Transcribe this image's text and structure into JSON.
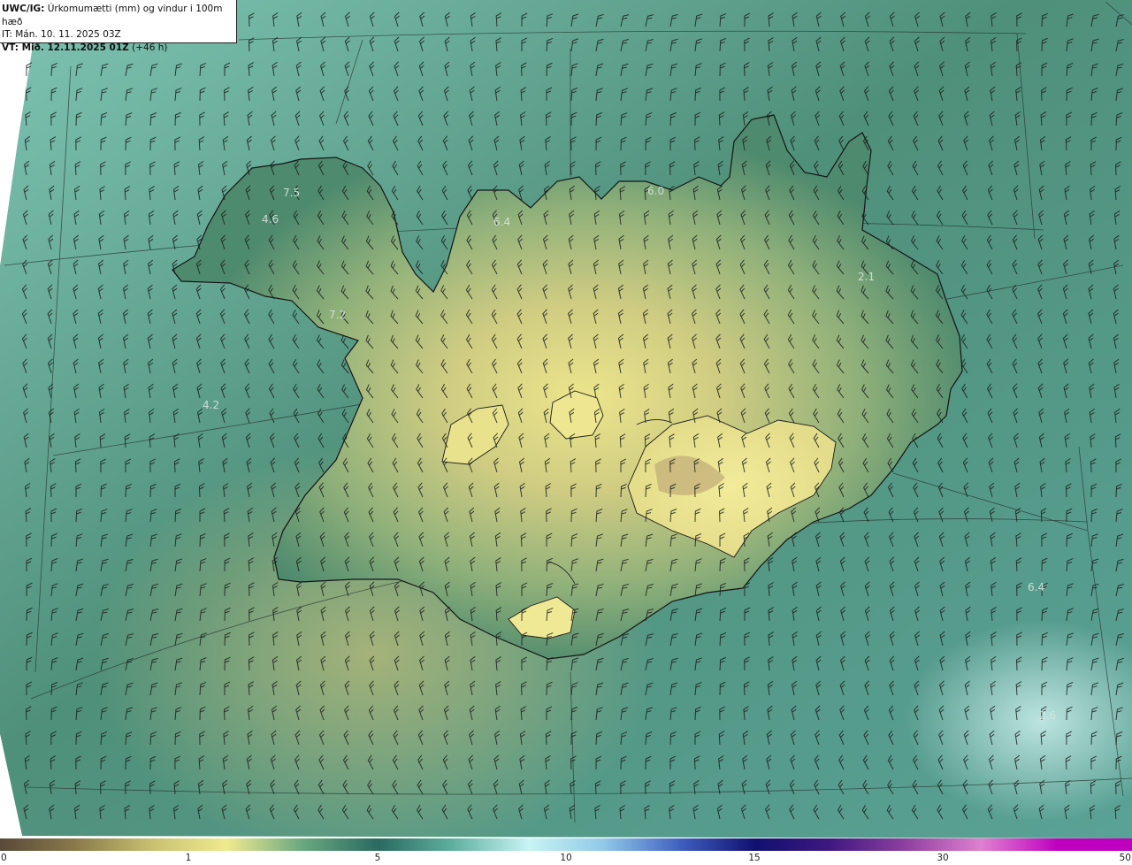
{
  "header": {
    "product_code": "UWC/IG:",
    "product_title": "Úrkomumætti (mm) og vindur i 100m hæð",
    "init_time": "IT: Mán. 10. 11. 2025 03Z",
    "valid_label": "VT: Mið. 12.11.2025 01Z",
    "lead_time": "(+46 h)"
  },
  "map_labels": [
    "7.5",
    "4.6",
    "6.4",
    "6.0",
    "2.1",
    "7.2",
    "4.2",
    "6.4",
    "2.6"
  ],
  "colorbar": {
    "tick_labels": [
      "0",
      "1",
      "5",
      "10",
      "15",
      "30",
      "50"
    ],
    "colors": [
      "#5a4a3a",
      "#8a7a4a",
      "#c8c070",
      "#f0ea90",
      "#6aa880",
      "#2a6a60",
      "#60b0a0",
      "#c8f4f4",
      "#90c8e8",
      "#4060c0",
      "#101070",
      "#401880",
      "#9040a0",
      "#e080d0",
      "#c000c0"
    ]
  }
}
